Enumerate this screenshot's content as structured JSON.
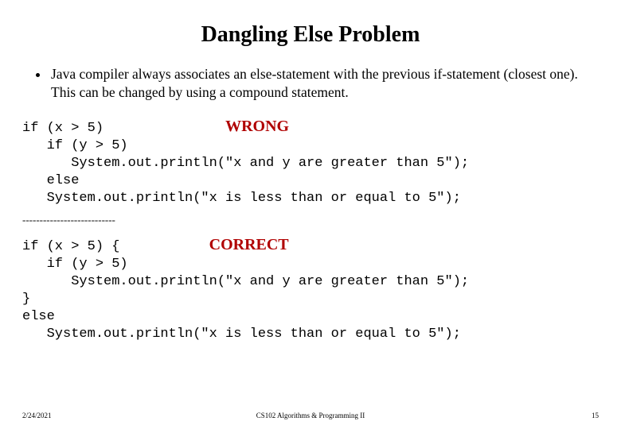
{
  "title": "Dangling Else Problem",
  "bullet": "Java compiler always associates an else-statement with the previous if-statement (closest one). This can be changed by using a compound statement.",
  "wrong": {
    "label": "WRONG",
    "line1": "if (x > 5)",
    "line2": "   if (y > 5)",
    "line3": "      System.out.println(\"x and y are greater than 5\");",
    "line4": "   else",
    "line5": "   System.out.println(\"x is less than or equal to 5\");"
  },
  "divider": "---------------------------",
  "correct": {
    "label": "CORRECT",
    "line1": "if (x > 5) {",
    "line2": "   if (y > 5)",
    "line3": "      System.out.println(\"x and y are greater than 5\");",
    "line4": "}",
    "line5": "else",
    "line6": "   System.out.println(\"x is less than or equal to 5\");"
  },
  "footer": {
    "date": "2/24/2021",
    "course": "CS102 Algorithms & Programming II",
    "page": "15"
  }
}
